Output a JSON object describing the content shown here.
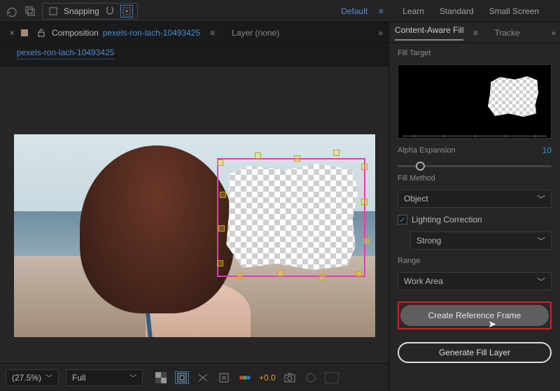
{
  "top": {
    "snapping_label": "Snapping",
    "workspaces": {
      "default": "Default",
      "learn": "Learn",
      "standard": "Standard",
      "small_screen": "Small Screen"
    }
  },
  "composition_panel": {
    "tab_prefix": "Composition",
    "tab_name": "pexels-ron-lach-10493425",
    "layer_tab": "Layer  (none)",
    "breadcrumb": "pexels-ron-lach-10493425"
  },
  "right_panel": {
    "tab_active": "Content-Aware Fill",
    "tab_other": "Tracke",
    "fill_target_label": "Fill Target",
    "alpha_expansion_label": "Alpha Expansion",
    "alpha_expansion_value": "10",
    "fill_method_label": "Fill Method",
    "fill_method_value": "Object",
    "lighting_correction_label": "Lighting Correction",
    "lighting_correction_checked": true,
    "lighting_value": "Strong",
    "range_label": "Range",
    "range_value": "Work Area",
    "btn_reference": "Create Reference Frame",
    "btn_generate": "Generate Fill Layer"
  },
  "footer": {
    "zoom": "(27.5%)",
    "resolution": "Full",
    "exposure": "+0.0"
  }
}
